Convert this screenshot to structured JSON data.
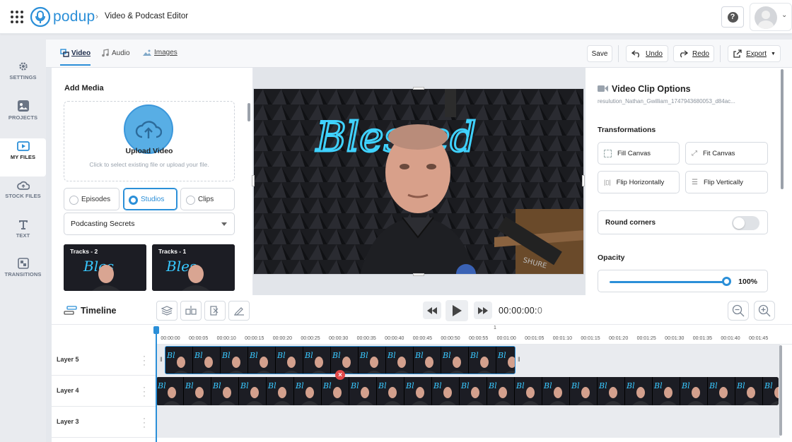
{
  "header": {
    "logo_text": "podup",
    "breadcrumb": "Video & Podcast Editor",
    "help_label": "?"
  },
  "sidebar": {
    "items": [
      {
        "label": "SETTINGS",
        "icon": "gear-icon"
      },
      {
        "label": "PROJECTS",
        "icon": "projects-icon"
      },
      {
        "label": "MY FILES",
        "icon": "my-files-icon",
        "active": true
      },
      {
        "label": "STOCK FILES",
        "icon": "cloud-icon"
      },
      {
        "label": "TEXT",
        "icon": "text-icon"
      },
      {
        "label": "TRANSITIONS",
        "icon": "transitions-icon"
      }
    ]
  },
  "toolbar": {
    "tabs": [
      {
        "label": "Video",
        "active": true
      },
      {
        "label": "Audio"
      },
      {
        "label": "Images"
      }
    ],
    "save_label": "Save",
    "undo_label": "Undo",
    "redo_label": "Redo",
    "export_label": "Export"
  },
  "media": {
    "heading": "Add Media",
    "upload_title": "Upload Video",
    "upload_hint": "Click to select existing file or upload your file.",
    "filters": [
      {
        "label": "Episodes"
      },
      {
        "label": "Studios",
        "selected": true
      },
      {
        "label": "Clips"
      }
    ],
    "show_select": "Podcasting Secrets",
    "thumbnails": [
      {
        "label": "Tracks - 2"
      },
      {
        "label": "Tracks - 1"
      }
    ]
  },
  "video_preview": {
    "neon_text": "Blessed",
    "mic_brand": "SHURE"
  },
  "clip_options": {
    "title": "Video Clip Options",
    "file_name": "resulution_Nathan_Gwilliam_1747943680053_d84ac...",
    "transformations_label": "Transformations",
    "buttons": {
      "fill_canvas": "Fill Canvas",
      "fit_canvas": "Fit Canvas",
      "flip_horizontally": "Flip Horizontally",
      "flip_vertically": "Flip Vertically"
    },
    "round_corners_label": "Round corners",
    "round_corners_on": false,
    "opacity_label": "Opacity",
    "opacity_value": "100%",
    "opacity_fraction": 1.0
  },
  "timeline": {
    "title": "Timeline",
    "timecode_main": "00:00:00:",
    "timecode_frame": "0",
    "minute_marker": "1",
    "ticks": [
      "00:00:00",
      "00:00:05",
      "00:00:10",
      "00:00:15",
      "00:00:20",
      "00:00:25",
      "00:00:30",
      "00:00:35",
      "00:00:40",
      "00:00:45",
      "00:00:50",
      "00:00:55",
      "00:01:00",
      "00:01:05",
      "00:01:10",
      "00:01:15",
      "00:01:20",
      "00:01:25",
      "00:01:30",
      "00:01:35",
      "00:01:40",
      "00:01:45"
    ],
    "layers": [
      "Layer 5",
      "Layer 4",
      "Layer 3"
    ]
  },
  "colors": {
    "accent": "#2b8fd8",
    "delete": "#e14848"
  }
}
